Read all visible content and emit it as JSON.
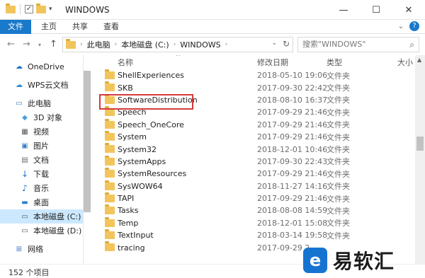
{
  "window": {
    "title": "WINDOWS",
    "controls": {
      "minimize": "—",
      "maximize": "☐",
      "close": "✕"
    }
  },
  "ribbon": {
    "tabs": [
      "文件",
      "主页",
      "共享",
      "查看"
    ]
  },
  "address": {
    "segments": [
      "此电脑",
      "本地磁盘 (C:)",
      "WINDOWS"
    ]
  },
  "search": {
    "placeholder": "搜索\"WINDOWS\""
  },
  "sidebar": {
    "items": [
      {
        "label": "OneDrive",
        "icon": "cloud-icon"
      },
      {
        "label": "WPS云文档",
        "icon": "wps-icon"
      },
      {
        "label": "此电脑",
        "icon": "computer-icon"
      },
      {
        "label": "3D 对象",
        "icon": "3d-objects-icon"
      },
      {
        "label": "视频",
        "icon": "video-icon"
      },
      {
        "label": "图片",
        "icon": "pictures-icon"
      },
      {
        "label": "文档",
        "icon": "documents-icon"
      },
      {
        "label": "下载",
        "icon": "download-icon"
      },
      {
        "label": "音乐",
        "icon": "music-icon"
      },
      {
        "label": "桌面",
        "icon": "desktop-icon"
      },
      {
        "label": "本地磁盘 (C:)",
        "icon": "drive-icon",
        "selected": true
      },
      {
        "label": "本地磁盘 (D:)",
        "icon": "drive-icon"
      },
      {
        "label": "网络",
        "icon": "network-icon"
      }
    ]
  },
  "columns": {
    "name": "名称",
    "date": "修改日期",
    "type": "类型",
    "size": "大小"
  },
  "files": [
    {
      "name": "ShellExperiences",
      "date": "2018-05-10 19:06",
      "type": "文件夹"
    },
    {
      "name": "SKB",
      "date": "2017-09-30 22:42",
      "type": "文件夹"
    },
    {
      "name": "SoftwareDistribution",
      "date": "2018-08-10 16:37",
      "type": "文件夹"
    },
    {
      "name": "Speech",
      "date": "2017-09-29 21:46",
      "type": "文件夹"
    },
    {
      "name": "Speech_OneCore",
      "date": "2017-09-29 21:46",
      "type": "文件夹"
    },
    {
      "name": "System",
      "date": "2017-09-29 21:46",
      "type": "文件夹"
    },
    {
      "name": "System32",
      "date": "2018-12-01 10:46",
      "type": "文件夹"
    },
    {
      "name": "SystemApps",
      "date": "2017-09-30 22:43",
      "type": "文件夹"
    },
    {
      "name": "SystemResources",
      "date": "2017-09-29 21:46",
      "type": "文件夹"
    },
    {
      "name": "SysWOW64",
      "date": "2018-11-27 14:16",
      "type": "文件夹"
    },
    {
      "name": "TAPI",
      "date": "2017-09-29 21:46",
      "type": "文件夹"
    },
    {
      "name": "Tasks",
      "date": "2018-08-08 14:59",
      "type": "文件夹"
    },
    {
      "name": "Temp",
      "date": "2018-12-01 15:08",
      "type": "文件夹"
    },
    {
      "name": "TextInput",
      "date": "2018-03-14 19:58",
      "type": "文件夹"
    },
    {
      "name": "tracing",
      "date": "2017-09-29 2",
      "type": ""
    }
  ],
  "highlighted_item": "SoftwareDistribution",
  "status": {
    "item_count": "152 个项目"
  },
  "watermark": {
    "logo": "e",
    "text": "易软汇"
  },
  "colors": {
    "accent": "#1979ca",
    "highlight_border": "#d43b3b",
    "folder": "#f2c55c"
  }
}
